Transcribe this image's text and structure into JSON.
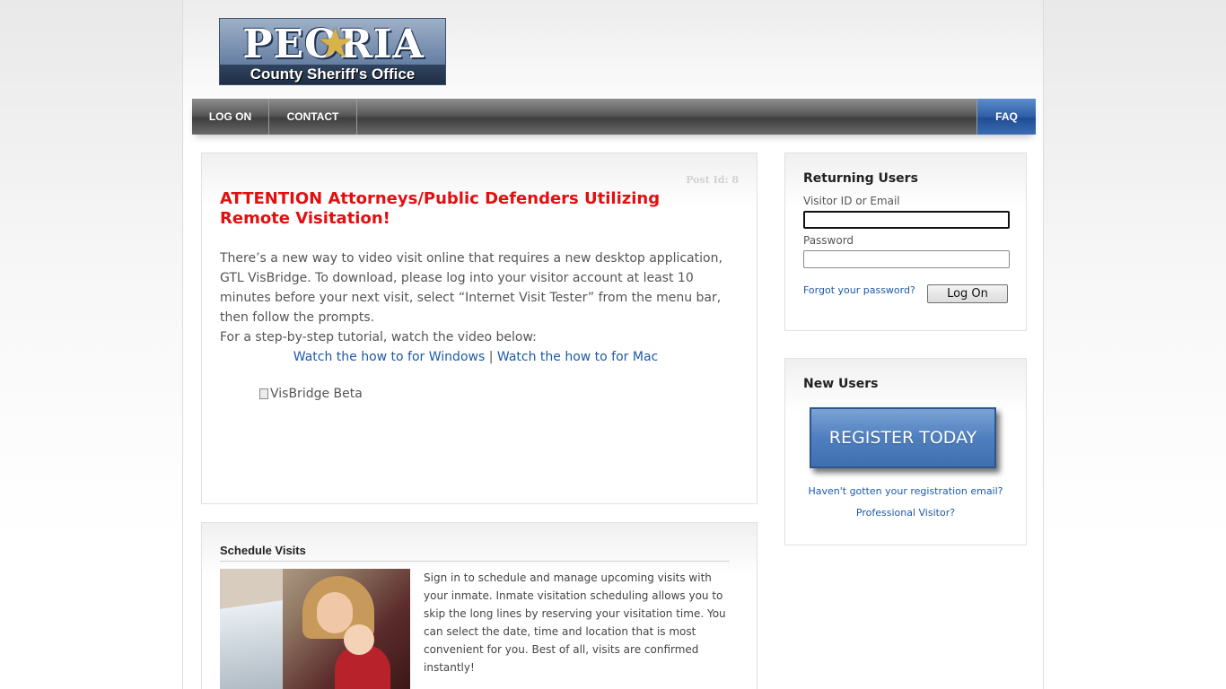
{
  "header": {
    "logo_title": "PEORIA",
    "logo_subtitle": "County Sheriff's Office"
  },
  "nav": {
    "items": [
      {
        "label": "LOG ON"
      },
      {
        "label": "CONTACT"
      }
    ],
    "faq_label": "FAQ"
  },
  "post": {
    "post_id": "Post Id: 8",
    "headline": "ATTENTION Attorneys/Public Defenders Utilizing Remote Visitation!",
    "paragraph1": "There’s a new way to video visit online that requires a new desktop application, GTL VisBridge. To download, please log into your visitor account at least 10 minutes before your next visit, select “Internet Visit Tester” from the menu bar, then follow the prompts.",
    "paragraph2": "For a step-by-step tutorial, watch the video below:",
    "link_windows": "Watch the how to for Windows",
    "link_separator": " | ",
    "link_mac": "Watch the how to for Mac",
    "image_alt": "VisBridge Beta"
  },
  "schedule": {
    "title": "Schedule Visits",
    "text": "Sign in to schedule and manage upcoming visits with your inmate. Inmate visitation scheduling allows you to skip the long lines by reserving your visitation time. You can select the date, time and location that is most convenient for you. Best of all, visits are confirmed instantly!"
  },
  "returning_users": {
    "title": "Returning Users",
    "visitor_label": "Visitor ID or Email",
    "visitor_value": "",
    "password_label": "Password",
    "password_value": "",
    "forgot_link": "Forgot your password?",
    "logon_button": "Log On"
  },
  "new_users": {
    "title": "New Users",
    "register_button": "REGISTER TODAY",
    "registration_email_link": "Haven't gotten your registration email?",
    "professional_link": "Professional Visitor?"
  },
  "colors": {
    "headline_red": "#e30f0f",
    "link_blue": "#1c5aa8",
    "faq_blue": "#2e5fa6",
    "nav_gray": "#4a4a4a"
  },
  "icons": {
    "broken_image": "broken-image-icon",
    "badge": "sheriff-star-icon"
  }
}
